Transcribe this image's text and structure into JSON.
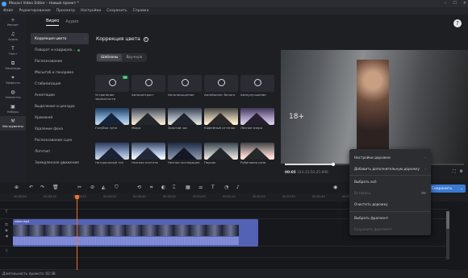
{
  "window": {
    "title": "Movavi Video Editor – Новый проект *"
  },
  "menu": [
    "Файл",
    "Редактирование",
    "Просмотр",
    "Настройки",
    "Сохранить",
    "Справка"
  ],
  "nav": [
    {
      "label": "Импорт",
      "icon": "import-icon"
    },
    {
      "label": "Аудио",
      "icon": "music-icon"
    },
    {
      "label": "Текст",
      "icon": "text-icon"
    },
    {
      "label": "Переходы",
      "icon": "transition-icon"
    },
    {
      "label": "Эффекты",
      "icon": "effects-icon"
    },
    {
      "label": "Элементы",
      "icon": "stickers-icon"
    },
    {
      "label": "Наборы",
      "icon": "kits-icon"
    },
    {
      "label": "Инструменты",
      "icon": "tools-icon"
    }
  ],
  "tabs": [
    "Видео",
    "Аудио"
  ],
  "sub": [
    "Коррекция цвета",
    "Поворот и кадриров...",
    "Распознавание",
    "Масштаб и панорама",
    "Стабилизация",
    "Аннотации",
    "Выделение и цензура",
    "Хромакей",
    "Удаление фона",
    "Распознавание сцен",
    "Логотип",
    "Замедленное движение"
  ],
  "section": {
    "title": "Коррекция цвета",
    "help": "?"
  },
  "toggles": [
    "Шаблоны",
    "Вручную"
  ],
  "presets": [
    "Устранение зернистости",
    "Автоконтраст",
    "Автонасыщение",
    "Автобаланс белого",
    "Автоулучшение",
    "Голубая луна",
    "Жара",
    "Золотой час",
    "Кофейный оттенок",
    "Лесное озеро",
    "Натуральный тон",
    "Нежная пастель",
    "Ночная экспедиция",
    "Персик",
    "Рубиновая роза"
  ],
  "preview": {
    "rating": "18+"
  },
  "player": {
    "time_current": "00:05",
    "time_rest": "333:23:50:25:990",
    "progress": 0.27
  },
  "save_label": "Сохранить",
  "ruler": [
    "00:00:00",
    "00:00:10",
    "00:00:20",
    "00:00:30",
    "00:00:40",
    "00:00:50",
    "00:01:00",
    "00:01:10",
    "00:01:20",
    "00:01:30",
    "00:01:40",
    "00:01:50"
  ],
  "clip": {
    "name": "video.mp4"
  },
  "context": {
    "items": [
      {
        "label": "Настройки дорожки",
        "disabled": false,
        "arrow": true
      },
      {
        "label": "Добавить дополнительную дорожку",
        "disabled": false,
        "arrow": true
      },
      {
        "label": "Выбрать всё",
        "disabled": false
      },
      {
        "label": "Вставить",
        "disabled": true
      },
      {
        "label": "Очистить дорожку",
        "disabled": false
      },
      {
        "label": "Выбрать фрагмент",
        "disabled": false
      },
      {
        "label": "Сохранить фрагмент",
        "disabled": true
      }
    ]
  },
  "status": "Длительность проекта: 02:38",
  "colors": {
    "accent": "#3a7bd5",
    "playhead": "#f07030",
    "clip": "#5462b5"
  }
}
